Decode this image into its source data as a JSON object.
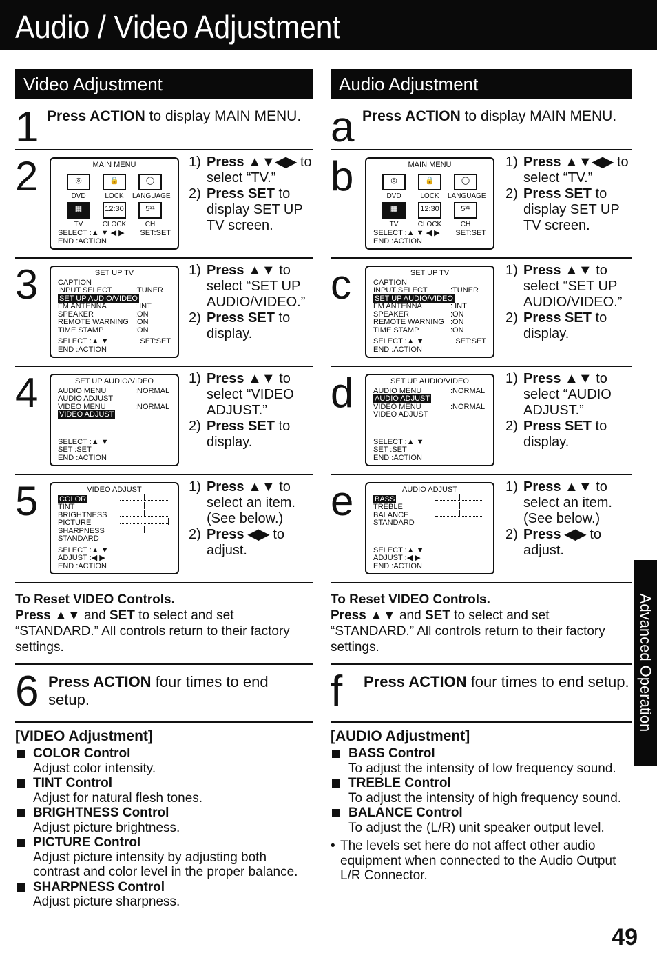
{
  "page": {
    "title": "Audio / Video Adjustment",
    "side_tab": "Advanced Operation",
    "page_number": "49"
  },
  "video": {
    "section_title": "Video Adjustment",
    "step1": {
      "num": "1",
      "bold": "Press ACTION",
      "rest": " to display MAIN MENU."
    },
    "step2": {
      "num": "2",
      "screen": {
        "title": "MAIN MENU",
        "icons": [
          {
            "label": "DVD",
            "glyph": "◎"
          },
          {
            "label": "LOCK",
            "glyph": "🔒"
          },
          {
            "label": "LANGUAGE",
            "glyph": "◯"
          },
          {
            "label": "TV",
            "glyph": "▦",
            "selected": true
          },
          {
            "label": "CLOCK",
            "glyph": "12:30"
          },
          {
            "label": "CH",
            "glyph": "5³¹"
          }
        ],
        "select": "SELECT :▲ ▼ ◀ ▶",
        "set": "SET:SET",
        "end": "END    :ACTION"
      },
      "instr": [
        {
          "n": "1)",
          "bold": "Press ▲▼◀▶",
          "rest": " to select “TV.”"
        },
        {
          "n": "2)",
          "bold": "Press SET",
          "rest": " to display SET UP TV screen."
        }
      ]
    },
    "step3": {
      "num": "3",
      "screen": {
        "title": "SET UP TV",
        "rows": [
          {
            "k": "CAPTION",
            "v": ""
          },
          {
            "k": "INPUT SELECT",
            "v": ":TUNER"
          },
          {
            "k": "SET UP AUDIO/VIDEO",
            "v": "",
            "highlight": true
          },
          {
            "k": "FM ANTENNA",
            "v": ": INT"
          },
          {
            "k": "SPEAKER",
            "v": ":ON"
          },
          {
            "k": "REMOTE WARNING",
            "v": ":ON"
          },
          {
            "k": "TIME STAMP",
            "v": ":ON"
          }
        ],
        "select": "SELECT :▲ ▼",
        "set": "SET:SET",
        "end": "END    :ACTION"
      },
      "instr": [
        {
          "n": "1)",
          "bold": "Press ▲▼",
          "rest": " to select “SET UP AUDIO/VIDEO.”"
        },
        {
          "n": "2)",
          "bold": "Press SET",
          "rest": " to display."
        }
      ]
    },
    "step4": {
      "num": "4",
      "screen": {
        "title": "SET UP AUDIO/VIDEO",
        "rows": [
          {
            "k": "AUDIO MENU",
            "v": ":NORMAL"
          },
          {
            "k": "AUDIO ADJUST",
            "v": ""
          },
          {
            "k": "VIDEO MENU",
            "v": ":NORMAL"
          },
          {
            "k": "VIDEO ADJUST",
            "v": "",
            "highlight": true
          }
        ],
        "select": "SELECT :▲ ▼",
        "set": "SET    :SET",
        "end": "END    :ACTION"
      },
      "instr": [
        {
          "n": "1)",
          "bold": "Press ▲▼",
          "rest": " to select “VIDEO ADJUST.”"
        },
        {
          "n": "2)",
          "bold": "Press SET",
          "rest": " to display."
        }
      ]
    },
    "step5": {
      "num": "5",
      "screen": {
        "title": "VIDEO ADJUST",
        "rows": [
          {
            "k": "COLOR",
            "level": 0.5,
            "highlight": true
          },
          {
            "k": "TINT",
            "level": 0.5
          },
          {
            "k": "BRIGHTNESS",
            "level": 0.5
          },
          {
            "k": "PICTURE",
            "level": 1.0
          },
          {
            "k": "SHARPNESS",
            "level": 0.5
          },
          {
            "k": "STANDARD"
          }
        ],
        "select": "SELECT :▲ ▼",
        "adjust": "ADJUST :◀ ▶",
        "end": "END    :ACTION"
      },
      "instr": [
        {
          "n": "1)",
          "bold": "Press ▲▼",
          "rest": " to select an item. (See below.)"
        },
        {
          "n": "2)",
          "bold": "Press ◀▶",
          "rest": " to adjust."
        }
      ]
    },
    "reset": {
      "title": "To Reset VIDEO Controls.",
      "bold1": "Press ▲▼",
      "mid": " and ",
      "bold2": "SET",
      "rest": " to select and set “STANDARD.” All controls return to their factory settings."
    },
    "step6": {
      "num": "6",
      "bold": "Press ACTION",
      "rest": " four times to end setup."
    },
    "desc": {
      "heading": "[VIDEO Adjustment]",
      "items": [
        {
          "name": "COLOR Control",
          "text": "Adjust color intensity."
        },
        {
          "name": "TINT Control",
          "text": "Adjust for natural flesh tones."
        },
        {
          "name": "BRIGHTNESS Control",
          "text": "Adjust picture brightness."
        },
        {
          "name": "PICTURE Control",
          "text": "Adjust picture intensity by adjusting both contrast and color level in the proper balance."
        },
        {
          "name": "SHARPNESS Control",
          "text": "Adjust picture sharpness."
        }
      ]
    }
  },
  "audio": {
    "section_title": "Audio Adjustment",
    "step1": {
      "num": "a",
      "bold": "Press ACTION",
      "rest": " to display MAIN MENU."
    },
    "step2": {
      "num": "b",
      "instr": [
        {
          "n": "1)",
          "bold": "Press ▲▼◀▶",
          "rest": " to select “TV.”"
        },
        {
          "n": "2)",
          "bold": "Press SET",
          "rest": " to display SET UP TV screen."
        }
      ]
    },
    "step3": {
      "num": "c",
      "instr": [
        {
          "n": "1)",
          "bold": "Press ▲▼",
          "rest": " to select “SET UP AUDIO/VIDEO.”"
        },
        {
          "n": "2)",
          "bold": "Press SET",
          "rest": " to display."
        }
      ]
    },
    "step4": {
      "num": "d",
      "screen": {
        "title": "SET UP AUDIO/VIDEO",
        "rows": [
          {
            "k": "AUDIO MENU",
            "v": ":NORMAL"
          },
          {
            "k": "AUDIO ADJUST",
            "v": "",
            "highlight": true
          },
          {
            "k": "VIDEO MENU",
            "v": ":NORMAL"
          },
          {
            "k": "VIDEO ADJUST",
            "v": ""
          }
        ],
        "select": "SELECT :▲ ▼",
        "set": "SET    :SET",
        "end": "END    :ACTION"
      },
      "instr": [
        {
          "n": "1)",
          "bold": "Press ▲▼",
          "rest": " to select “AUDIO ADJUST.”"
        },
        {
          "n": "2)",
          "bold": "Press SET",
          "rest": " to display."
        }
      ]
    },
    "step5": {
      "num": "e",
      "screen": {
        "title": "AUDIO ADJUST",
        "rows": [
          {
            "k": "BASS",
            "level": 0.5,
            "highlight": true
          },
          {
            "k": "TREBLE",
            "level": 0.5
          },
          {
            "k": "BALANCE",
            "level": 0.5
          },
          {
            "k": "STANDARD"
          }
        ],
        "select": "SELECT :▲ ▼",
        "adjust": "ADJUST :◀ ▶",
        "end": "END    :ACTION"
      },
      "instr": [
        {
          "n": "1)",
          "bold": "Press ▲▼",
          "rest": " to select an item. (See below.)"
        },
        {
          "n": "2)",
          "bold": "Press ◀▶",
          "rest": " to adjust."
        }
      ]
    },
    "reset": {
      "title": "To Reset VIDEO Controls.",
      "bold1": "Press ▲▼",
      "mid": " and ",
      "bold2": "SET",
      "rest": " to select and set “STANDARD.” All controls return to their factory settings."
    },
    "step6": {
      "num": "f",
      "bold": "Press ACTION",
      "rest": " four times to end setup."
    },
    "desc": {
      "heading": "[AUDIO Adjustment]",
      "items": [
        {
          "name": "BASS Control",
          "text": "To adjust the intensity of low frequency sound."
        },
        {
          "name": "TREBLE Control",
          "text": "To adjust the intensity of high frequency sound."
        },
        {
          "name": "BALANCE Control",
          "text": "To adjust the (L/R) unit speaker output level."
        }
      ],
      "note": "The levels set here do not affect other audio equipment when connected to the Audio Output L/R Connector."
    }
  }
}
